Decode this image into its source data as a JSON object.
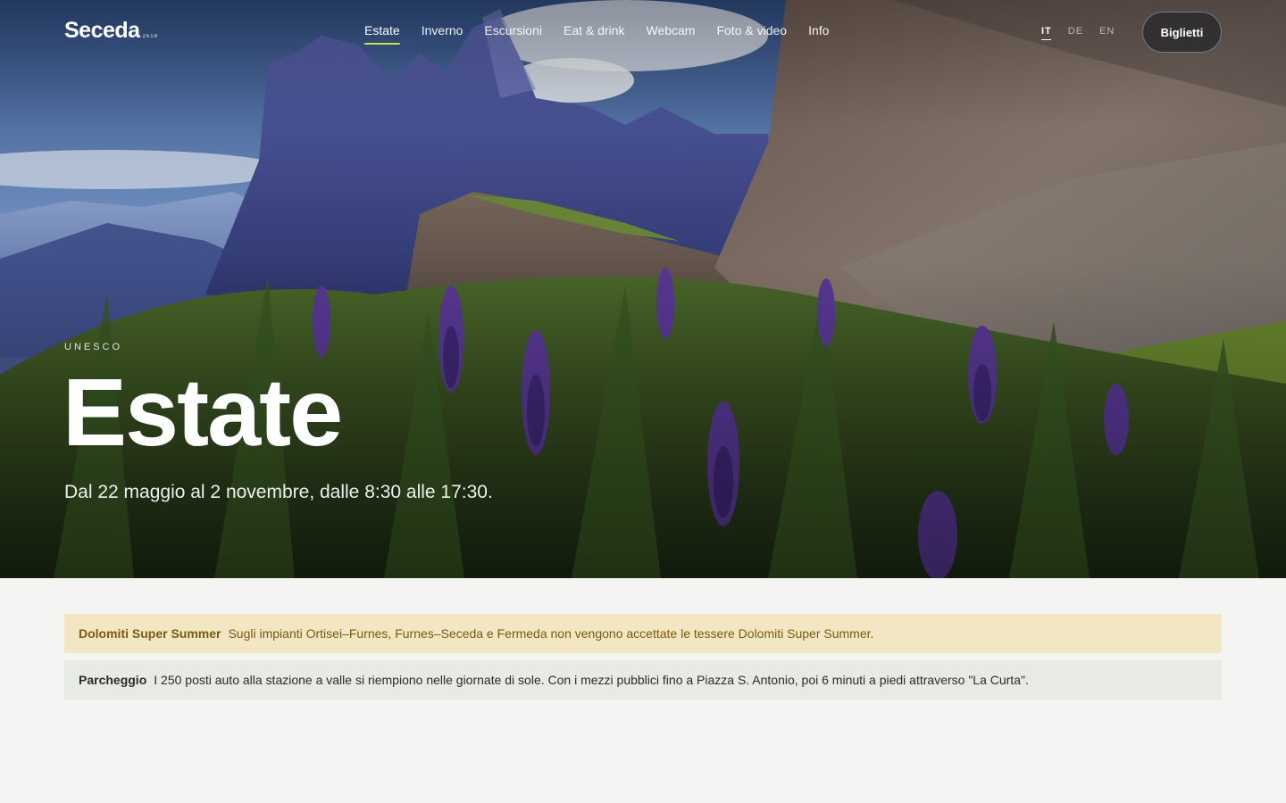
{
  "brand": {
    "name": "Seceda",
    "altitude": "2518"
  },
  "nav": {
    "items": [
      {
        "label": "Estate",
        "active": true
      },
      {
        "label": "Inverno",
        "active": false
      },
      {
        "label": "Escursioni",
        "active": false
      },
      {
        "label": "Eat & drink",
        "active": false
      },
      {
        "label": "Webcam",
        "active": false
      },
      {
        "label": "Foto & video",
        "active": false
      },
      {
        "label": "Info",
        "active": false
      }
    ]
  },
  "languages": [
    {
      "code": "IT",
      "active": true
    },
    {
      "code": "DE",
      "active": false
    },
    {
      "code": "EN",
      "active": false
    }
  ],
  "tickets_button": "Biglietti",
  "hero": {
    "eyebrow": "UNESCO",
    "title": "Estate",
    "subtitle": "Dal 22 maggio al 2 novembre, dalle 8:30 alle 17:30.",
    "image": "mountain-landscape-with-purple-flowers"
  },
  "notices": [
    {
      "type": "warning",
      "title": "Dolomiti Super Summer",
      "text": "Sugli impianti Ortisei–Furnes, Furnes–Seceda e Fermeda non vengono accettate le tessere Dolomiti Super Summer."
    },
    {
      "type": "info",
      "title": "Parcheggio",
      "text": "I 250 posti auto alla stazione a valle si riempiono nelle giornate di sole. Con i mezzi pubblici fino a Piazza S. Antonio, poi 6 minuti a piedi attraverso \"La Curta\"."
    }
  ],
  "colors": {
    "accent": "#c7e05a",
    "warning_bg": "#f3e6c3",
    "warning_text": "#7a5b12",
    "info_bg": "#e8eae6",
    "page_bg": "#f4f4f3"
  }
}
